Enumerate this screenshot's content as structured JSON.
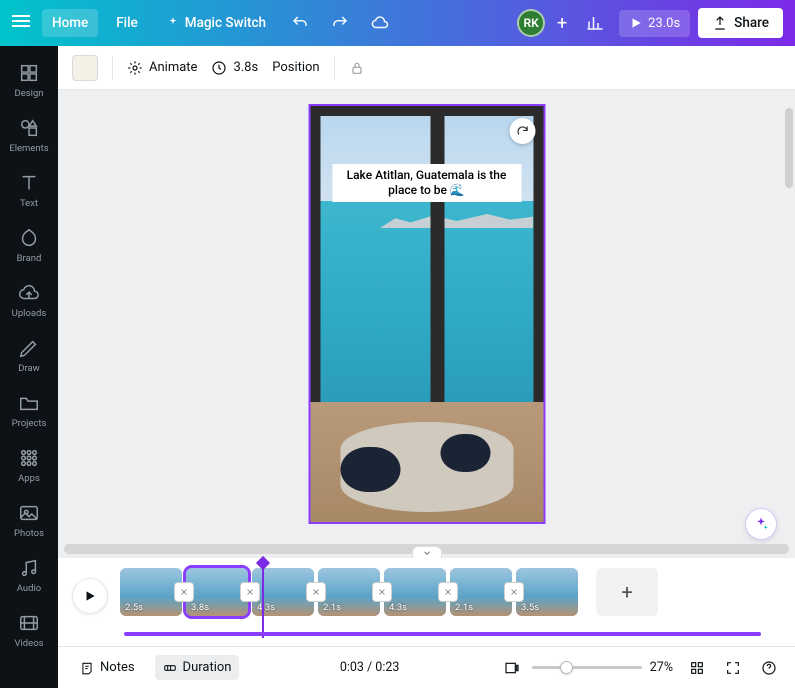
{
  "topbar": {
    "home": "Home",
    "file": "File",
    "magic": "Magic Switch",
    "avatar_initials": "RK",
    "play_duration": "23.0s",
    "share": "Share"
  },
  "sidebar": {
    "items": [
      {
        "label": "Design",
        "icon": "design"
      },
      {
        "label": "Elements",
        "icon": "elements"
      },
      {
        "label": "Text",
        "icon": "text"
      },
      {
        "label": "Brand",
        "icon": "brand"
      },
      {
        "label": "Uploads",
        "icon": "uploads"
      },
      {
        "label": "Draw",
        "icon": "draw"
      },
      {
        "label": "Projects",
        "icon": "projects"
      },
      {
        "label": "Apps",
        "icon": "apps"
      },
      {
        "label": "Photos",
        "icon": "photos"
      },
      {
        "label": "Audio",
        "icon": "audio"
      },
      {
        "label": "Videos",
        "icon": "videos"
      }
    ]
  },
  "toolbar": {
    "swatch_color": "#f4f0e6",
    "animate": "Animate",
    "duration": "3.8s",
    "position": "Position"
  },
  "canvas": {
    "caption": "Lake Atitlan, Guatemala is the place to be 🌊"
  },
  "timeline": {
    "clips": [
      {
        "duration": "2.5s",
        "selected": false
      },
      {
        "duration": "3.8s",
        "selected": true
      },
      {
        "duration": "4.3s",
        "selected": false
      },
      {
        "duration": "2.1s",
        "selected": false
      },
      {
        "duration": "4.3s",
        "selected": false
      },
      {
        "duration": "2.1s",
        "selected": false
      },
      {
        "duration": "3.5s",
        "selected": false
      }
    ]
  },
  "bottombar": {
    "notes": "Notes",
    "duration": "Duration",
    "time": "0:03 / 0:23",
    "zoom": "27%"
  }
}
